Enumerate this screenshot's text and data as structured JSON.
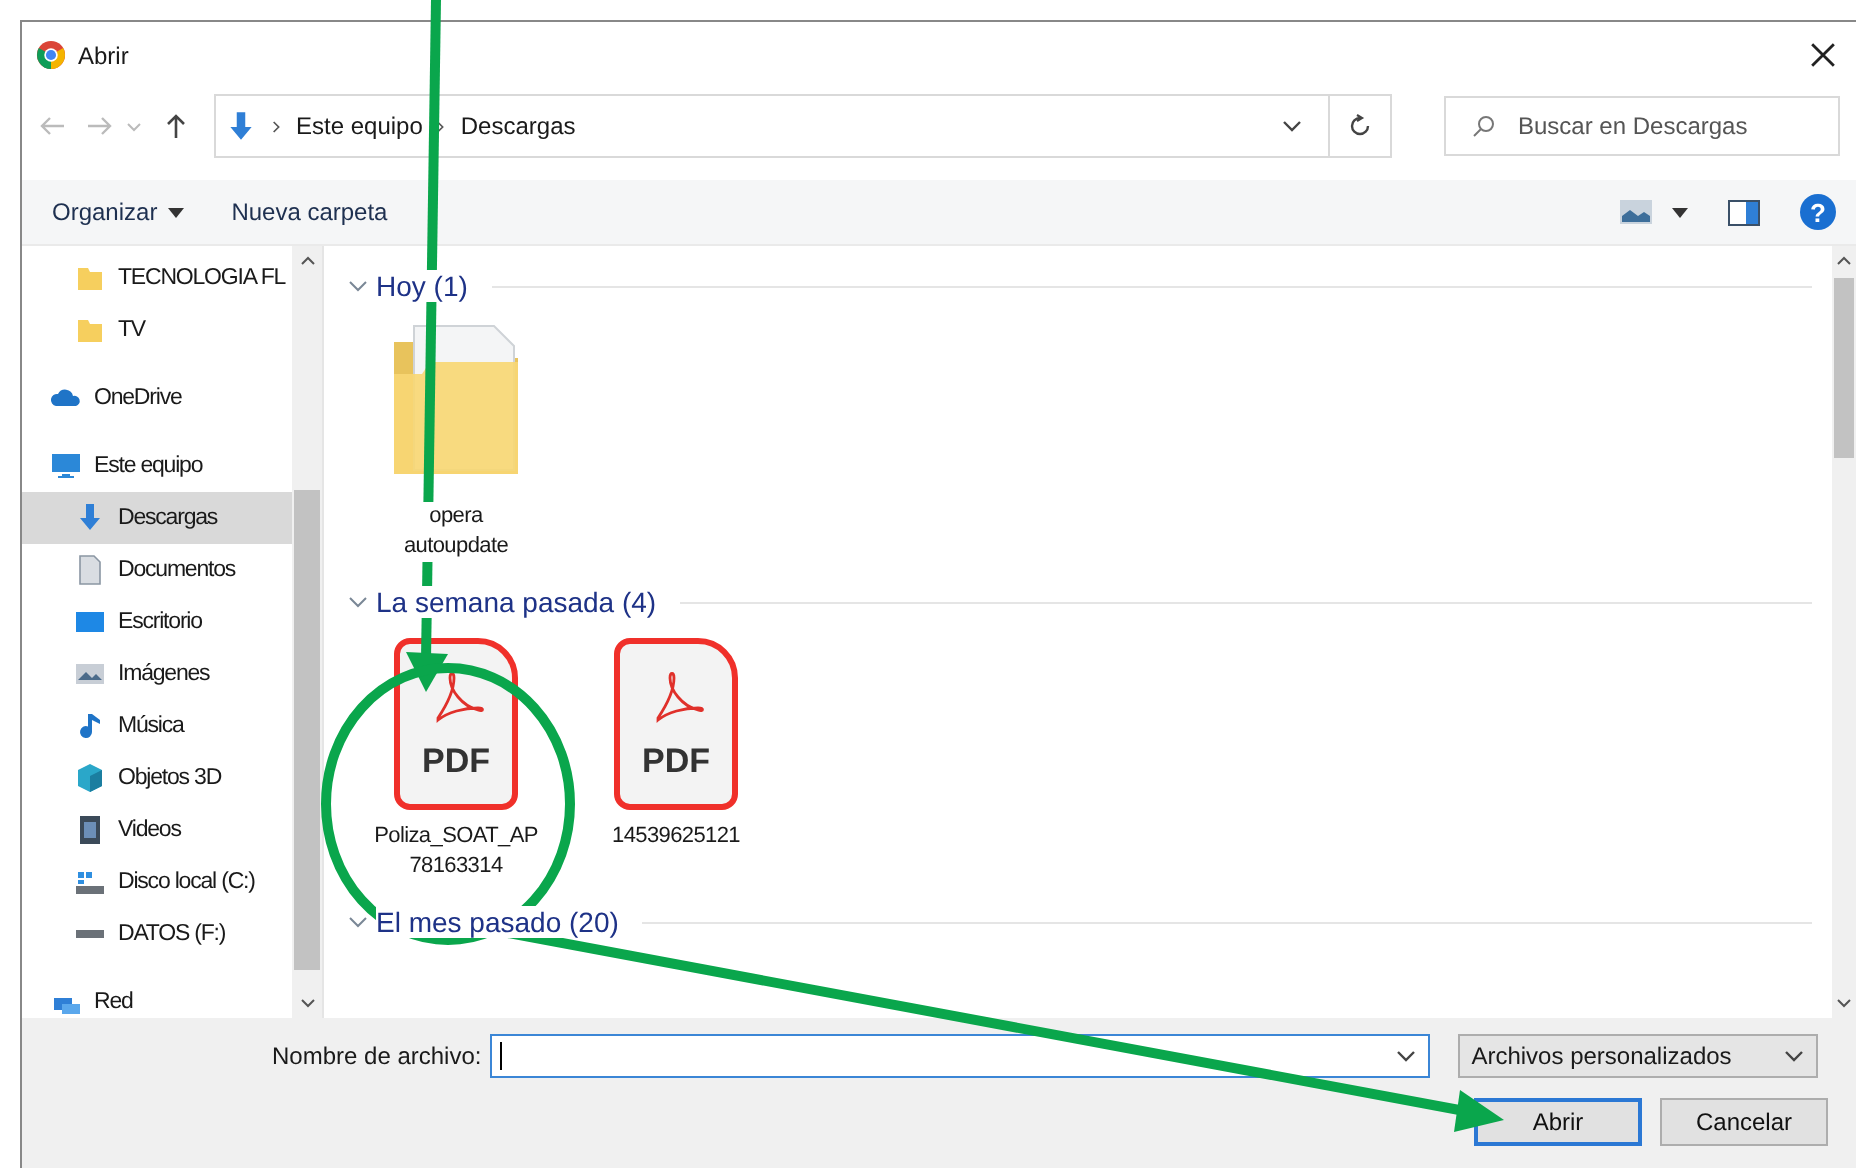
{
  "window": {
    "title": "Abrir"
  },
  "address_bar": {
    "crumbs": [
      "Este equipo",
      "Descargas"
    ]
  },
  "search": {
    "placeholder": "Buscar en Descargas"
  },
  "toolbar": {
    "organize": "Organizar",
    "new_folder": "Nueva carpeta",
    "help": "?"
  },
  "sidebar": {
    "leading_children": [
      {
        "label": "TECNOLOGIA FL",
        "kind": "folder",
        "selected": false
      },
      {
        "label": "TV",
        "kind": "folder",
        "selected": false
      }
    ],
    "items": [
      {
        "label": "OneDrive",
        "kind": "cloud",
        "selected": false
      },
      {
        "label": "Este equipo",
        "kind": "computer",
        "selected": false,
        "children": [
          {
            "label": "Descargas",
            "kind": "download",
            "selected": true
          },
          {
            "label": "Documentos",
            "kind": "document",
            "selected": false
          },
          {
            "label": "Escritorio",
            "kind": "desktop",
            "selected": false
          },
          {
            "label": "Imágenes",
            "kind": "pictures",
            "selected": false
          },
          {
            "label": "Música",
            "kind": "music",
            "selected": false
          },
          {
            "label": "Objetos 3D",
            "kind": "cube",
            "selected": false
          },
          {
            "label": "Videos",
            "kind": "video",
            "selected": false
          },
          {
            "label": "Disco local (C:)",
            "kind": "system-drive",
            "selected": false
          },
          {
            "label": "DATOS (F:)",
            "kind": "drive",
            "selected": false
          }
        ]
      },
      {
        "label": "Red",
        "kind": "network",
        "selected": false
      }
    ]
  },
  "groups": [
    {
      "label": "Hoy (1)",
      "expanded": true,
      "files": [
        {
          "name_lines": [
            "opera",
            "autoupdate"
          ],
          "kind": "folder"
        }
      ]
    },
    {
      "label": "La semana pasada (4)",
      "expanded": true,
      "files": [
        {
          "name_lines": [
            "Poliza_SOAT_AP",
            "78163314"
          ],
          "kind": "pdf",
          "badge": "PDF"
        },
        {
          "name_lines": [
            "14539625121"
          ],
          "kind": "pdf",
          "badge": "PDF"
        }
      ]
    },
    {
      "label": "El mes pasado (20)",
      "expanded": true
    }
  ],
  "footer": {
    "filename_label": "Nombre de archivo:",
    "filter": "Archivos personalizados",
    "buttons": [
      {
        "label": "Abrir",
        "default": true
      },
      {
        "label": "Cancelar",
        "default": false
      }
    ]
  }
}
